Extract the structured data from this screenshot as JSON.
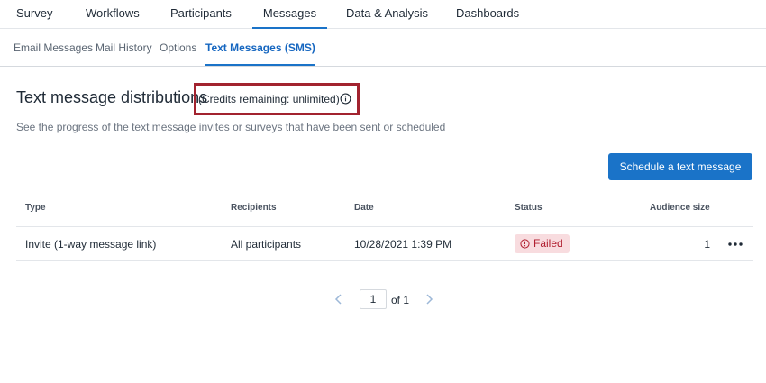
{
  "top_nav": {
    "tabs": [
      {
        "label": "Survey"
      },
      {
        "label": "Workflows"
      },
      {
        "label": "Participants"
      },
      {
        "label": "Messages"
      },
      {
        "label": "Data & Analysis"
      },
      {
        "label": "Dashboards"
      }
    ],
    "active": "Messages"
  },
  "sub_nav": {
    "tabs": [
      {
        "label": "Email Messages"
      },
      {
        "label": "Mail History"
      },
      {
        "label": "Options"
      },
      {
        "label": "Text Messages (SMS)"
      }
    ],
    "active": "Text Messages (SMS)"
  },
  "header": {
    "title": "Text message distributions",
    "credits": "(Credits remaining: unlimited)",
    "subtitle": "See the progress of the text message invites or surveys that have been sent or scheduled"
  },
  "actions": {
    "schedule_label": "Schedule a text message"
  },
  "table": {
    "columns": [
      "Type",
      "Recipients",
      "Date",
      "Status",
      "Audience size"
    ],
    "rows": [
      {
        "type": "Invite (1-way message link)",
        "recipients": "All participants",
        "date": "10/28/2021 1:39 PM",
        "status": "Failed",
        "audience_size": "1"
      }
    ]
  },
  "pagination": {
    "current_page": "1",
    "of_label": "of 1"
  },
  "colors": {
    "accent": "#1a73c8",
    "highlight_box": "#a2232f",
    "failed_text": "#b01e2f",
    "failed_bg": "#f8dcdf"
  },
  "icons": {
    "credits_info": "info-icon",
    "status_failed": "alert-circle-icon",
    "row_menu": "more-horizontal-icon",
    "prev": "chevron-left-icon",
    "next": "chevron-right-icon"
  }
}
